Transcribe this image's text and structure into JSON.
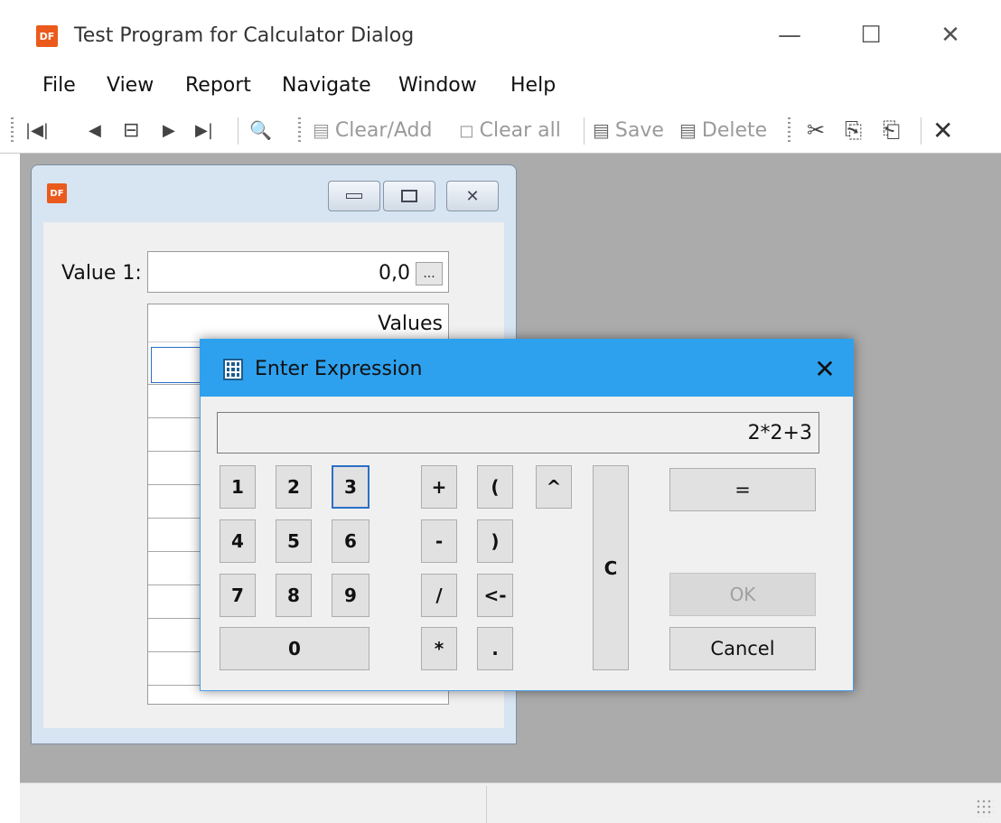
{
  "window": {
    "title": "Test Program for Calculator Dialog",
    "app_icon_text": "DF",
    "controls": {
      "minimize": "—",
      "maximize": "☐",
      "close": "✕"
    }
  },
  "menu": [
    "File",
    "View",
    "Report",
    "Navigate",
    "Window",
    "Help"
  ],
  "toolbar": {
    "nav": {
      "first": "|◀|",
      "prev": "◀",
      "middle": "⊟",
      "next": "▶",
      "last": "▶|",
      "search": "🔍"
    },
    "clear_add": "Clear/Add",
    "clear_all": "Clear all",
    "save": "Save",
    "delete": "Delete",
    "cut_icon": "✂",
    "copy_icon": "⎘",
    "paste_icon": "⎗",
    "close_icon": "✕"
  },
  "child_window": {
    "icon_text": "DF",
    "value_label": "Value 1:",
    "value": "0,0",
    "ellipsis": "...",
    "grid_header": "Values"
  },
  "dialog": {
    "title": "Enter Expression",
    "close": "✕",
    "expression": "2*2+3",
    "digits": [
      "1",
      "2",
      "3",
      "4",
      "5",
      "6",
      "7",
      "8",
      "9",
      "0"
    ],
    "ops": {
      "plus": "+",
      "lparen": "(",
      "caret": "^",
      "minus": "-",
      "rparen": ")",
      "divide": "/",
      "backspace": "<-",
      "multiply": "*",
      "dot": "."
    },
    "clear": "C",
    "equals": "=",
    "ok": "OK",
    "cancel": "Cancel"
  }
}
